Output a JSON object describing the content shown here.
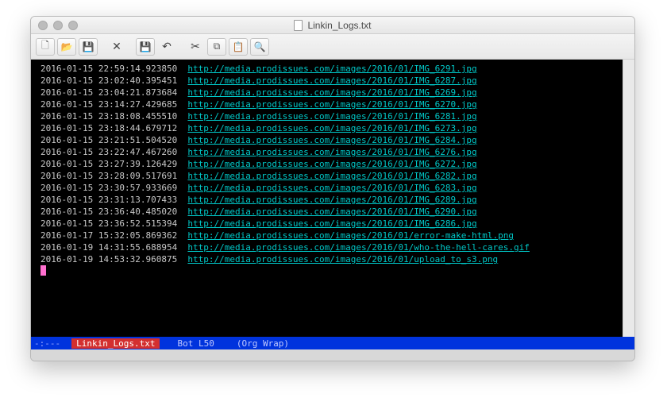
{
  "window": {
    "title": "Linkin_Logs.txt"
  },
  "toolbar": {
    "new_icon": "🗋",
    "open_icon": "📂",
    "save_icon": "💾",
    "close_symbol": "✕",
    "save2_icon": "💾",
    "undo_icon": "↶",
    "cut_icon": "✂",
    "copy_icon": "⧉",
    "paste_icon": "📋",
    "find_icon": "🔍"
  },
  "colors": {
    "timestamp": "#c8c8c8",
    "url": "#00c8c8",
    "cursor": "#ff6fcf",
    "modeline_bg": "#0033dd",
    "modeline_file_bg": "#d32f2f",
    "editor_bg": "#000000"
  },
  "log": [
    {
      "ts": "2016-01-15 22:59:14.923850",
      "url": "http://media.prodissues.com/images/2016/01/IMG_6291.jpg"
    },
    {
      "ts": "2016-01-15 23:02:40.395451",
      "url": "http://media.prodissues.com/images/2016/01/IMG_6287.jpg"
    },
    {
      "ts": "2016-01-15 23:04:21.873684",
      "url": "http://media.prodissues.com/images/2016/01/IMG_6269.jpg"
    },
    {
      "ts": "2016-01-15 23:14:27.429685",
      "url": "http://media.prodissues.com/images/2016/01/IMG_6270.jpg"
    },
    {
      "ts": "2016-01-15 23:18:08.455510",
      "url": "http://media.prodissues.com/images/2016/01/IMG_6281.jpg"
    },
    {
      "ts": "2016-01-15 23:18:44.679712",
      "url": "http://media.prodissues.com/images/2016/01/IMG_6273.jpg"
    },
    {
      "ts": "2016-01-15 23:21:51.504520",
      "url": "http://media.prodissues.com/images/2016/01/IMG_6284.jpg"
    },
    {
      "ts": "2016-01-15 23:22:47.467260",
      "url": "http://media.prodissues.com/images/2016/01/IMG_6276.jpg"
    },
    {
      "ts": "2016-01-15 23:27:39.126429",
      "url": "http://media.prodissues.com/images/2016/01/IMG_6272.jpg"
    },
    {
      "ts": "2016-01-15 23:28:09.517691",
      "url": "http://media.prodissues.com/images/2016/01/IMG_6282.jpg"
    },
    {
      "ts": "2016-01-15 23:30:57.933669",
      "url": "http://media.prodissues.com/images/2016/01/IMG_6283.jpg"
    },
    {
      "ts": "2016-01-15 23:31:13.707433",
      "url": "http://media.prodissues.com/images/2016/01/IMG_6289.jpg"
    },
    {
      "ts": "2016-01-15 23:36:40.485020",
      "url": "http://media.prodissues.com/images/2016/01/IMG_6290.jpg"
    },
    {
      "ts": "2016-01-15 23:36:52.515394",
      "url": "http://media.prodissues.com/images/2016/01/IMG_6286.jpg"
    },
    {
      "ts": "2016-01-17 15:32:05.869362",
      "url": "http://media.prodissues.com/images/2016/01/error-make-html.png"
    },
    {
      "ts": "2016-01-19 14:31:55.688954",
      "url": "http://media.prodissues.com/images/2016/01/who-the-hell-cares.gif"
    },
    {
      "ts": "2016-01-19 14:53:32.960875",
      "url": "http://media.prodissues.com/images/2016/01/upload_to_s3.png"
    }
  ],
  "modeline": {
    "left": "-:---",
    "filename": "Linkin_Logs.txt",
    "position": "Bot L50",
    "mode": "(Org Wrap)"
  }
}
